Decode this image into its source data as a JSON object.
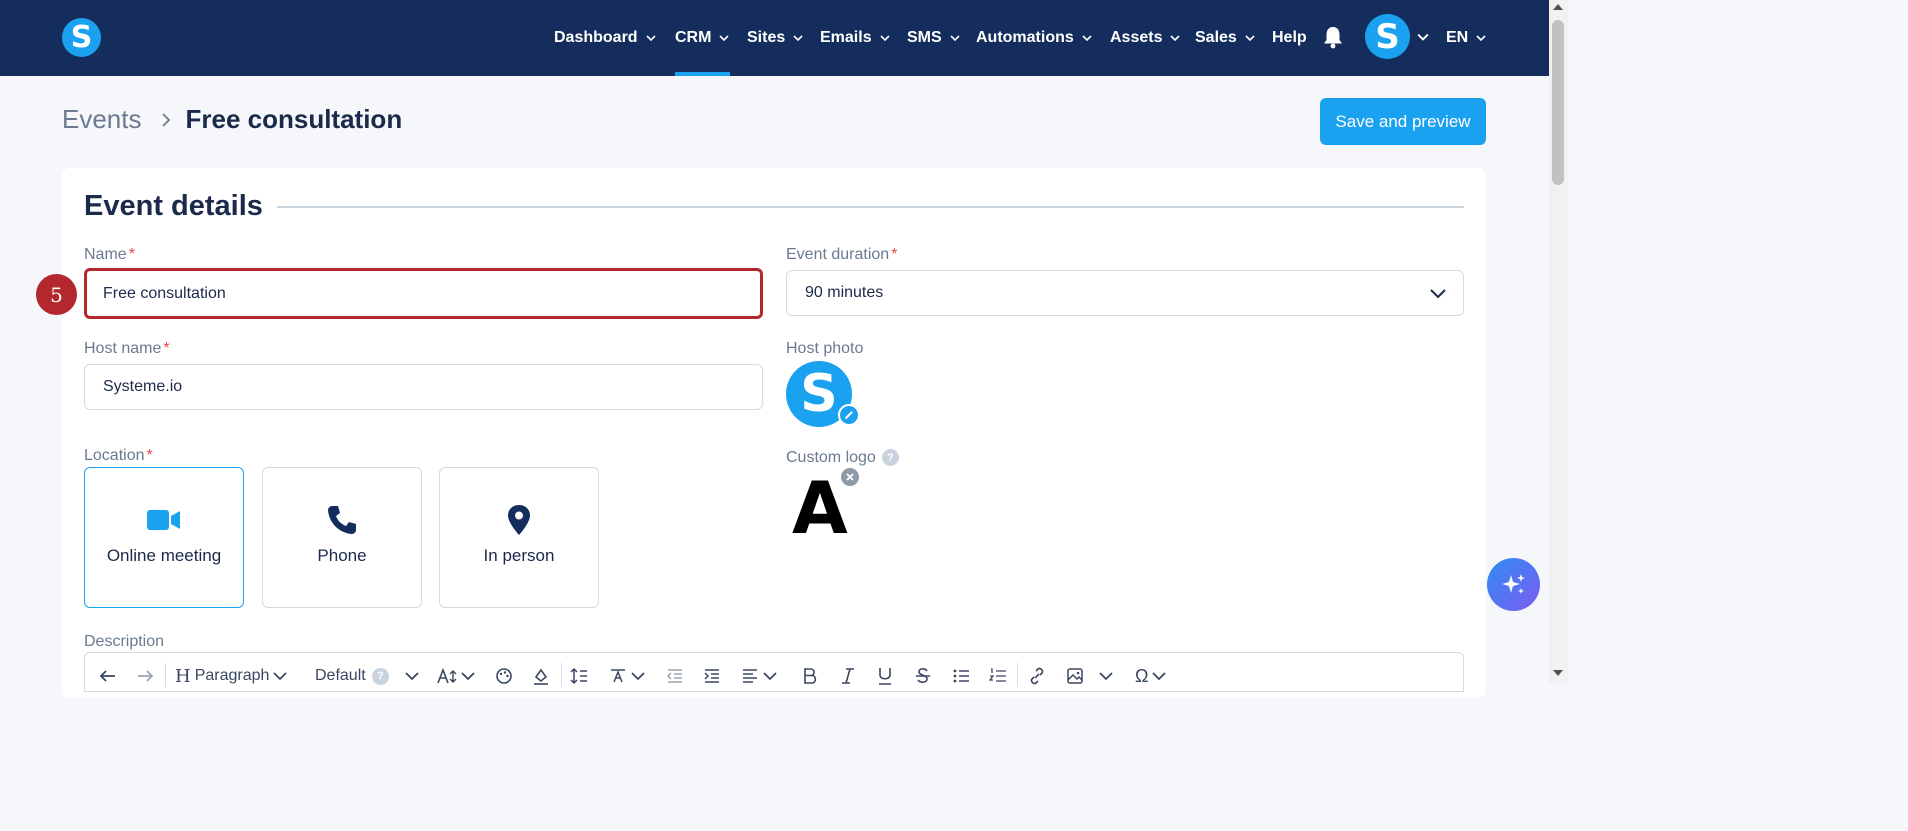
{
  "nav": {
    "logo_letter": "S",
    "items": [
      {
        "label": "Dashboard",
        "has_dropdown": true
      },
      {
        "label": "CRM",
        "has_dropdown": true,
        "active": true
      },
      {
        "label": "Sites",
        "has_dropdown": true
      },
      {
        "label": "Emails",
        "has_dropdown": true
      },
      {
        "label": "SMS",
        "has_dropdown": true
      },
      {
        "label": "Automations",
        "has_dropdown": true
      },
      {
        "label": "Assets",
        "has_dropdown": true
      },
      {
        "label": "Sales",
        "has_dropdown": true
      },
      {
        "label": "Help",
        "has_dropdown": false
      }
    ],
    "avatar_letter": "S",
    "language": "EN",
    "colors": {
      "background": "#142d5c",
      "accent": "#1aa1f0"
    }
  },
  "breadcrumb": {
    "parent": "Events",
    "current": "Free consultation"
  },
  "save_button": "Save and preview",
  "section_title": "Event details",
  "step_badge": "5",
  "fields": {
    "name": {
      "label": "Name",
      "value": "Free consultation",
      "required": true
    },
    "event_duration": {
      "label": "Event duration",
      "value": "90 minutes",
      "required": true
    },
    "host_name": {
      "label": "Host name",
      "value": "Systeme.io",
      "required": true
    },
    "host_photo": {
      "label": "Host photo",
      "letter": "S"
    },
    "custom_logo": {
      "label": "Custom logo",
      "help": "?",
      "logo_letter": "A"
    },
    "location": {
      "label": "Location",
      "required": true,
      "options": [
        {
          "label": "Online meeting",
          "icon": "video-icon",
          "selected": true
        },
        {
          "label": "Phone",
          "icon": "phone-icon",
          "selected": false
        },
        {
          "label": "In person",
          "icon": "map-pin-icon",
          "selected": false
        }
      ]
    },
    "description": {
      "label": "Description"
    }
  },
  "toolbar": {
    "paragraph": "Paragraph",
    "font": "Default",
    "font_help": "?"
  }
}
